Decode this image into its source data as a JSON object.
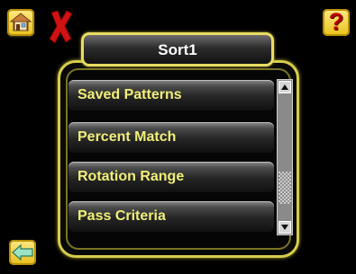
{
  "title": "Sort1",
  "list": {
    "items": [
      {
        "label": "Saved Patterns"
      },
      {
        "label": "Percent Match"
      },
      {
        "label": "Rotation Range"
      },
      {
        "label": "Pass Criteria"
      }
    ]
  },
  "icons": {
    "home": "home-icon",
    "close": "close-icon",
    "help": "help-icon",
    "back": "back-arrow-icon"
  },
  "help_glyph": "?",
  "scrollbar": {
    "position_fraction": 0.82
  },
  "colors": {
    "accent": "#e8dc63",
    "item_text": "#f2ef78",
    "button_bg": "#f4d44a",
    "close_red": "#d11212"
  }
}
